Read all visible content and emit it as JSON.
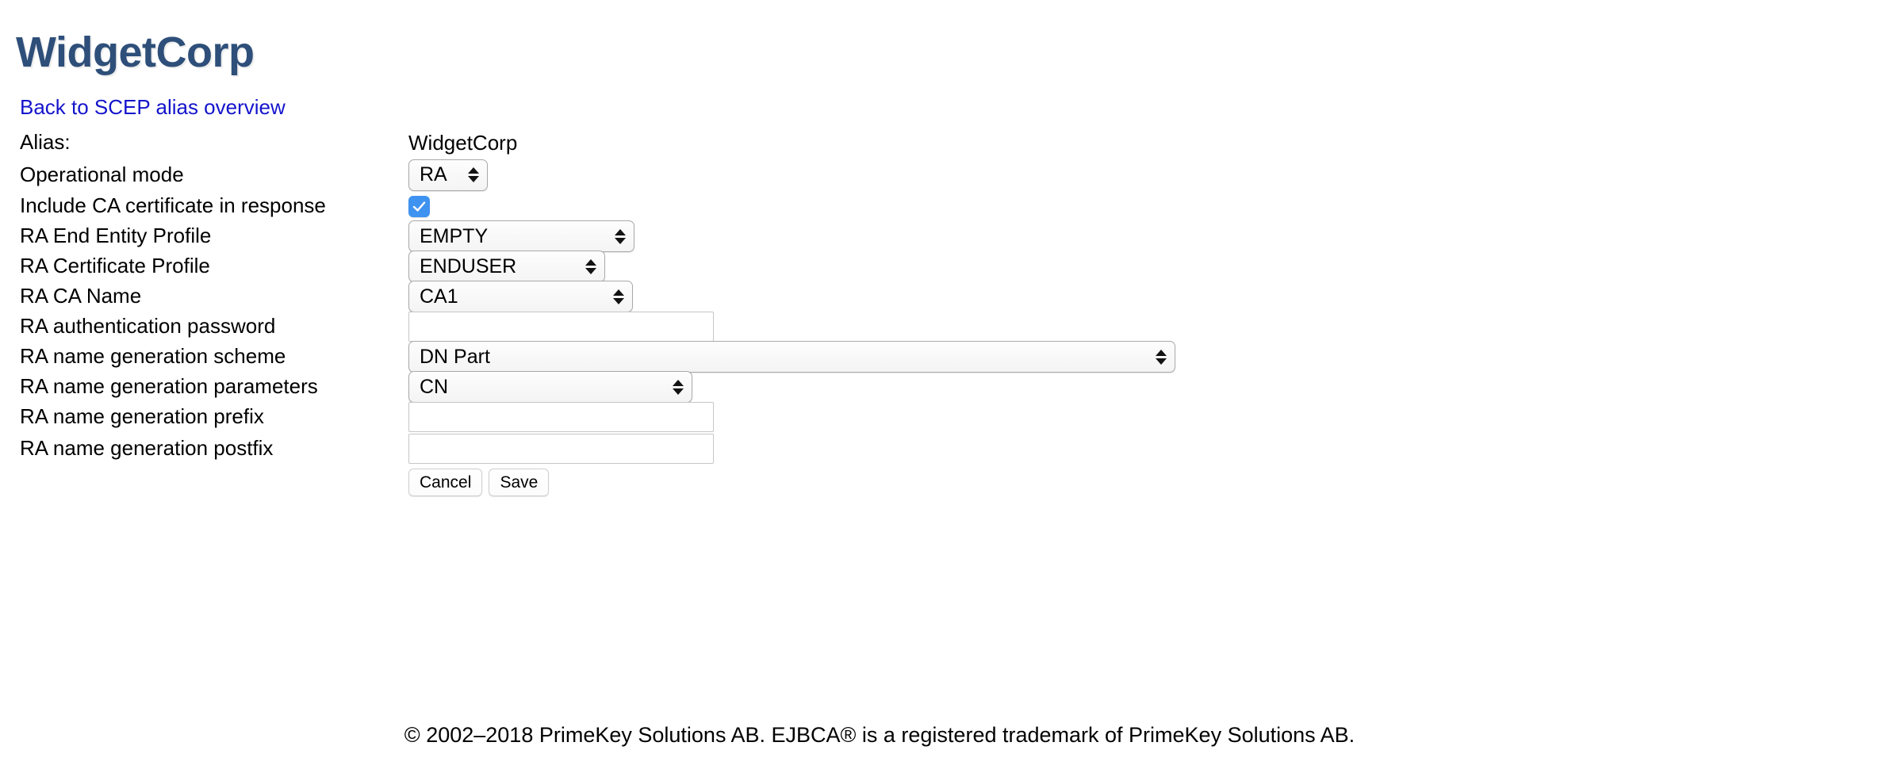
{
  "header": {
    "title": "WidgetCorp",
    "title_color": "#2e4f79"
  },
  "back_link": {
    "label": "Back to SCEP alias overview",
    "color": "#1414cc"
  },
  "form": {
    "rows": [
      {
        "label": "Alias:",
        "type": "static",
        "value": "WidgetCorp"
      },
      {
        "label": "Operational mode",
        "type": "select",
        "value": "RA"
      },
      {
        "label": "Include CA certificate in response",
        "type": "checkbox",
        "checked": true
      },
      {
        "label": "RA End Entity Profile",
        "type": "select",
        "value": "EMPTY"
      },
      {
        "label": "RA Certificate Profile",
        "type": "select",
        "value": "ENDUSER"
      },
      {
        "label": "RA CA Name",
        "type": "select",
        "value": "CA1"
      },
      {
        "label": "RA authentication password",
        "type": "text",
        "value": "",
        "placeholder": ""
      },
      {
        "label": "RA name generation scheme",
        "type": "select",
        "value": "DN Part"
      },
      {
        "label": "RA name generation parameters",
        "type": "select",
        "value": "CN"
      },
      {
        "label": "RA name generation prefix",
        "type": "text",
        "value": "",
        "placeholder": ""
      },
      {
        "label": "RA name generation postfix",
        "type": "text",
        "value": "",
        "placeholder": ""
      }
    ],
    "labels": {
      "alias": "Alias:",
      "operational_mode": "Operational mode",
      "include_ca_cert": "Include CA certificate in response",
      "ra_end_entity_profile": "RA End Entity Profile",
      "ra_certificate_profile": "RA Certificate Profile",
      "ra_ca_name": "RA CA Name",
      "ra_auth_password": "RA authentication password",
      "ra_name_gen_scheme": "RA name generation scheme",
      "ra_name_gen_params": "RA name generation parameters",
      "ra_name_gen_prefix": "RA name generation prefix",
      "ra_name_gen_postfix": "RA name generation postfix"
    },
    "values": {
      "alias": "WidgetCorp",
      "operational_mode": "RA",
      "ra_end_entity_profile": "EMPTY",
      "ra_certificate_profile": "ENDUSER",
      "ra_ca_name": "CA1",
      "ra_auth_password": "",
      "ra_name_gen_scheme": "DN Part",
      "ra_name_gen_params": "CN",
      "ra_name_gen_prefix": "",
      "ra_name_gen_postfix": ""
    },
    "placeholders": {
      "ra_auth_password": "",
      "ra_name_gen_prefix": "",
      "ra_name_gen_postfix": ""
    }
  },
  "buttons": {
    "cancel": "Cancel",
    "save": "Save"
  },
  "footer": {
    "text": "© 2002–2018 PrimeKey Solutions AB. EJBCA® is a registered trademark of PrimeKey Solutions AB."
  },
  "icons": {
    "checkbox_check": "check-icon",
    "select_stepper": "stepper-updown-icon"
  },
  "colors": {
    "title": "#2e4f79",
    "link": "#1414cc",
    "checkbox_on": "#3f93f0",
    "page_background": "#ffffff"
  }
}
